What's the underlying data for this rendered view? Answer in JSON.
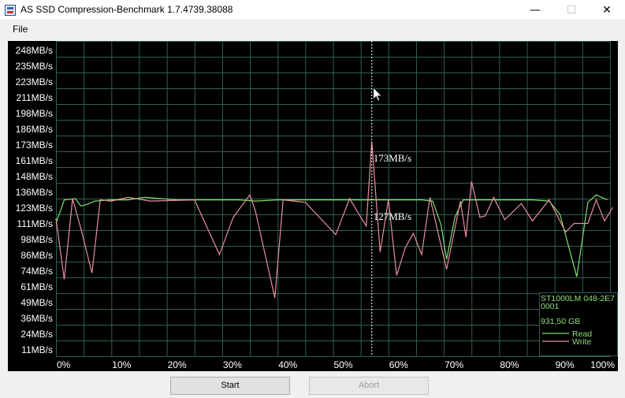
{
  "window": {
    "title": "AS SSD Compression-Benchmark 1.7.4739.38088",
    "minimize_glyph": "—",
    "maximize_glyph": "☐",
    "close_glyph": "✕"
  },
  "menu": {
    "file": "File"
  },
  "buttons": {
    "start": "Start",
    "abort": "Abort"
  },
  "colors": {
    "background": "#000000",
    "grid": "#2f5f52",
    "read": "#7ee06b",
    "write": "#e8909e",
    "text": "#ffffff",
    "legend_text": "#8fe07a"
  },
  "chart_data": {
    "type": "line",
    "y_tick_labels": [
      "248MB/s",
      "235MB/s",
      "223MB/s",
      "211MB/s",
      "198MB/s",
      "186MB/s",
      "173MB/s",
      "161MB/s",
      "148MB/s",
      "136MB/s",
      "123MB/s",
      "111MB/s",
      "98MB/s",
      "86MB/s",
      "74MB/s",
      "61MB/s",
      "49MB/s",
      "36MB/s",
      "24MB/s",
      "11MB/s"
    ],
    "x_tick_labels": [
      "0%",
      "10%",
      "20%",
      "30%",
      "40%",
      "50%",
      "60%",
      "70%",
      "80%",
      "90%",
      "100%"
    ],
    "ylim": [
      0,
      254
    ],
    "xlim": [
      0,
      100
    ],
    "grid": true,
    "legend_position": "bottom-right",
    "legend": {
      "device": "ST1000LM 048-2E7",
      "firmware": "0001",
      "capacity": "931,50 GB",
      "read_label": "Read",
      "write_label": "Write"
    },
    "cursor": {
      "x": 57,
      "write_label": "173MB/s",
      "read_label": "127MB/s"
    },
    "series": [
      {
        "name": "Read",
        "color": "#7ee06b",
        "points": [
          [
            0,
            107
          ],
          [
            1.5,
            126
          ],
          [
            3.5,
            127
          ],
          [
            4.5,
            121
          ],
          [
            6,
            123
          ],
          [
            7,
            125
          ],
          [
            10,
            126
          ],
          [
            13,
            126
          ],
          [
            16,
            128
          ],
          [
            22,
            126
          ],
          [
            26,
            126
          ],
          [
            30,
            126
          ],
          [
            33,
            126
          ],
          [
            36,
            125
          ],
          [
            40,
            126
          ],
          [
            44,
            126
          ],
          [
            48,
            126
          ],
          [
            52,
            126
          ],
          [
            55,
            126
          ],
          [
            57,
            126
          ],
          [
            60,
            126
          ],
          [
            63,
            126
          ],
          [
            66,
            126
          ],
          [
            68,
            125
          ],
          [
            69.5,
            106
          ],
          [
            70.5,
            78
          ],
          [
            72,
            112
          ],
          [
            73.5,
            126
          ],
          [
            76,
            126
          ],
          [
            78,
            126
          ],
          [
            80,
            126
          ],
          [
            83,
            126
          ],
          [
            86,
            126
          ],
          [
            89,
            125
          ],
          [
            91,
            114
          ],
          [
            94,
            64
          ],
          [
            96,
            124
          ],
          [
            97.5,
            130
          ],
          [
            99.5,
            126
          ]
        ]
      },
      {
        "name": "Write",
        "color": "#e8909e",
        "points": [
          [
            0,
            111
          ],
          [
            1.5,
            62
          ],
          [
            3,
            127
          ],
          [
            4.5,
            103
          ],
          [
            6.5,
            67
          ],
          [
            8,
            126
          ],
          [
            10,
            125
          ],
          [
            13,
            128
          ],
          [
            17,
            125
          ],
          [
            25,
            126
          ],
          [
            29.5,
            82
          ],
          [
            32,
            112
          ],
          [
            35,
            130
          ],
          [
            36,
            117
          ],
          [
            39.5,
            47
          ],
          [
            41,
            126
          ],
          [
            45,
            124
          ],
          [
            50.5,
            98
          ],
          [
            53,
            127
          ],
          [
            55,
            112
          ],
          [
            56,
            105
          ],
          [
            57,
            173
          ],
          [
            58.5,
            84
          ],
          [
            60,
            126
          ],
          [
            61.5,
            65
          ],
          [
            63,
            87
          ],
          [
            64.5,
            99
          ],
          [
            66,
            82
          ],
          [
            67.5,
            128
          ],
          [
            70.5,
            70
          ],
          [
            73,
            125
          ],
          [
            74,
            96
          ],
          [
            75,
            141
          ],
          [
            76.5,
            112
          ],
          [
            77.5,
            113
          ],
          [
            79,
            128
          ],
          [
            81,
            110
          ],
          [
            84,
            123
          ],
          [
            86,
            109
          ],
          [
            89,
            126
          ],
          [
            92,
            100
          ],
          [
            93.5,
            107
          ],
          [
            96,
            107
          ],
          [
            97.5,
            126
          ],
          [
            99,
            109
          ],
          [
            100.5,
            120
          ]
        ]
      }
    ]
  }
}
